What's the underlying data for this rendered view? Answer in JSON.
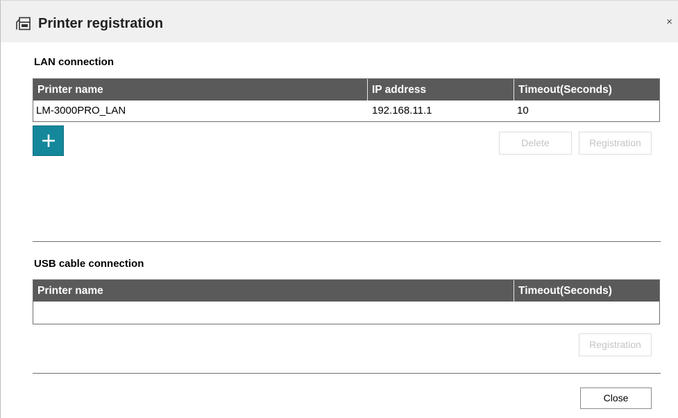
{
  "window": {
    "title": "Printer registration",
    "close_glyph": "×",
    "title_icon": "printer-registration-icon"
  },
  "lan": {
    "section_title": "LAN connection",
    "columns": [
      "Printer name",
      "IP address",
      "Timeout(Seconds)"
    ],
    "rows": [
      {
        "printer_name": "LM-3000PRO_LAN",
        "ip_address": "192.168.11.1",
        "timeout": "10"
      }
    ],
    "add_icon": "plus-icon",
    "add_button_color": "#14879b",
    "delete_label": "Delete",
    "registration_label": "Registration"
  },
  "usb": {
    "section_title": "USB cable connection",
    "columns": [
      "Printer name",
      "Timeout(Seconds)"
    ],
    "registration_label": "Registration"
  },
  "footer": {
    "close_label": "Close"
  },
  "colors": {
    "header_bg": "#5a5a5a",
    "accent": "#14879b"
  }
}
